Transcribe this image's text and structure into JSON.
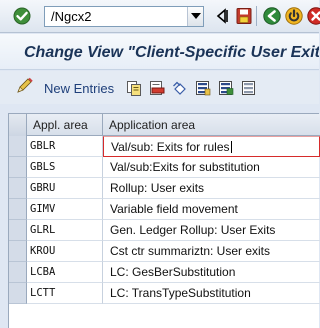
{
  "command_bar": {
    "command_value": "/Ngcx2",
    "icons": [
      "enter-checkmark-icon",
      "dropdown-arrow-icon",
      "back-arrow-icon",
      "save-icon",
      "green-back-icon",
      "yellow-exit-icon",
      "red-cancel-icon"
    ]
  },
  "title": "Change View \"Client-Specific User Exits\": Overview",
  "app_toolbar": {
    "new_entries_label": "New Entries",
    "icons": [
      "copy-icon",
      "delete-icon",
      "undo-icon",
      "select-all-icon",
      "select-block-icon",
      "deselect-icon"
    ]
  },
  "table": {
    "columns": [
      "Appl. area",
      "Application area"
    ],
    "rows": [
      {
        "code": "GBLR",
        "text": "Val/sub: Exits for rules"
      },
      {
        "code": "GBLS",
        "text": "Val/sub:Exits for substitution"
      },
      {
        "code": "GBRU",
        "text": "Rollup: User exits"
      },
      {
        "code": "GIMV",
        "text": "Variable field movement"
      },
      {
        "code": "GLRL",
        "text": "Gen. Ledger Rollup: User Exits"
      },
      {
        "code": "KROU",
        "text": "Cst ctr summariztn: User exits"
      },
      {
        "code": "LCBA",
        "text": "LC: GesBerSubstitution"
      },
      {
        "code": "LCTT",
        "text": "LC: TransTypeSubstitution"
      }
    ]
  },
  "colors": {
    "title_text": "#1a3357",
    "focus_border": "#d62b2b",
    "selector_column": "#d4dce8"
  }
}
